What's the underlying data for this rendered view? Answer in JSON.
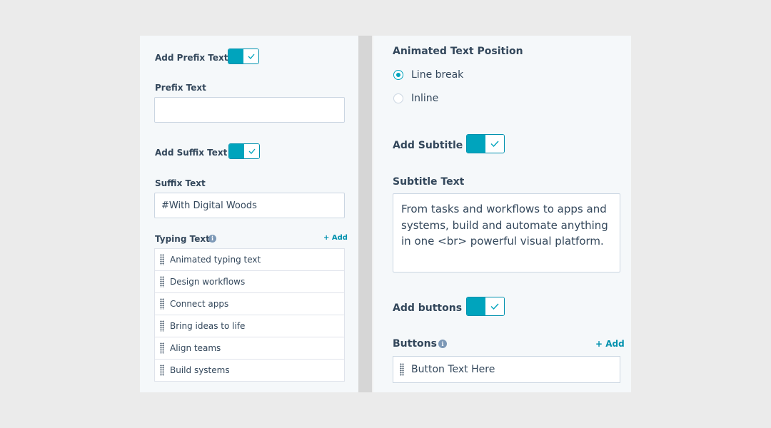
{
  "left": {
    "prefix_toggle_label": "Add Prefix Text",
    "prefix_label": "Prefix Text",
    "prefix_value": "",
    "suffix_toggle_label": "Add Suffix Text",
    "suffix_label": "Suffix Text",
    "suffix_value": "#With Digital Woods",
    "typing_label": "Typing Text",
    "add_label": "+ Add",
    "typing_items": [
      "Animated typing text",
      "Design workflows",
      "Connect apps",
      "Bring ideas to life",
      "Align teams",
      "Build systems"
    ]
  },
  "right": {
    "position_label": "Animated Text Position",
    "radio_options": [
      "Line break",
      "Inline"
    ],
    "subtitle_toggle_label": "Add Subtitle",
    "subtitle_label": "Subtitle Text",
    "subtitle_value": "From tasks and workflows to apps and systems, build and automate anything in one <br> powerful visual platform.",
    "buttons_toggle_label": "Add buttons",
    "buttons_label": "Buttons",
    "add_label": "+ Add",
    "button_items": [
      "Button Text Here"
    ]
  },
  "colors": {
    "accent": "#00a4bd",
    "accent_border": "#0091ae",
    "text": "#33475b",
    "panel_bg": "#f5f8fa",
    "page_bg": "#ebebeb"
  },
  "icons": [
    "checkmark-icon",
    "info-icon",
    "drag-handle-icon"
  ]
}
